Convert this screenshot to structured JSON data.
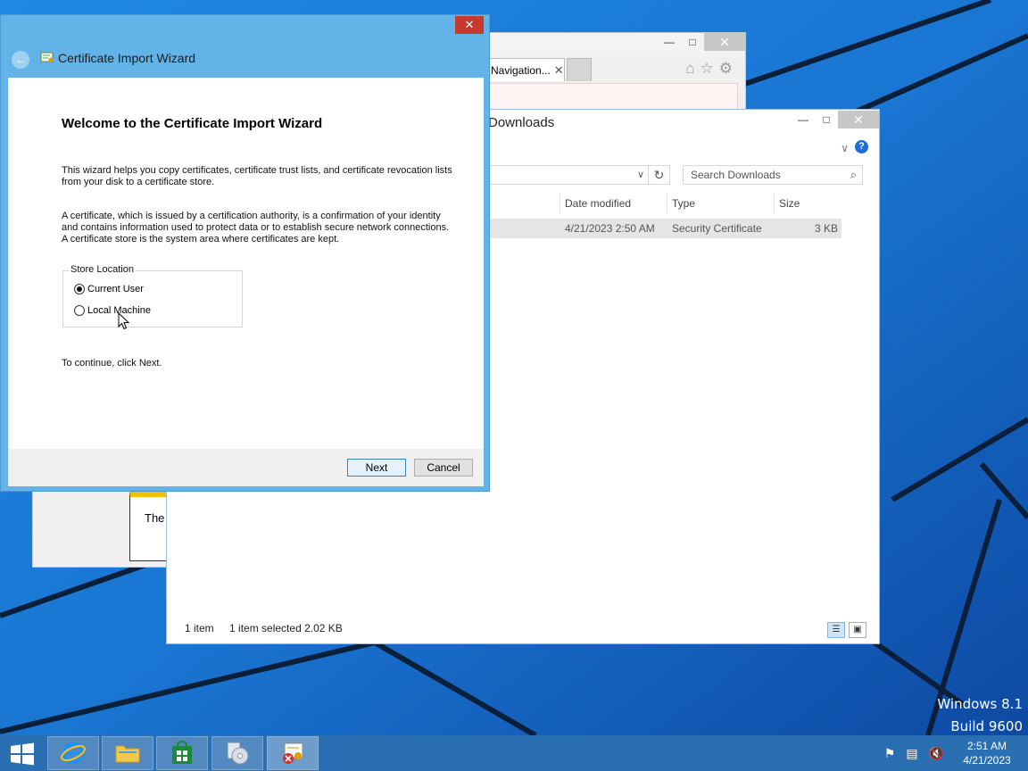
{
  "desktop": {
    "watermark_line1": "Windows 8.1",
    "watermark_line2": "Build 9600"
  },
  "ie": {
    "tab_label": "Navigation...",
    "page_text": "The"
  },
  "explorer": {
    "title": "Downloads",
    "search_placeholder": "Search Downloads",
    "columns": {
      "date_modified": "Date modified",
      "type": "Type",
      "size": "Size"
    },
    "file": {
      "date_modified": "4/21/2023 2:50 AM",
      "type": "Security Certificate",
      "size": "3 KB"
    },
    "status": {
      "count": "1 item",
      "selected": "1 item selected  2.02 KB"
    }
  },
  "wizard": {
    "title": "Certificate Import Wizard",
    "heading": "Welcome to the Certificate Import Wizard",
    "para1": "This wizard helps you copy certificates, certificate trust lists, and certificate revocation lists from your disk to a certificate store.",
    "para2": "A certificate, which is issued by a certification authority, is a confirmation of your identity and contains information used to protect data or to establish secure network connections. A certificate store is the system area where certificates are kept.",
    "store_location": {
      "legend": "Store Location",
      "options": [
        {
          "label": "Current User",
          "selected": true
        },
        {
          "label": "Local Machine",
          "selected": false
        }
      ]
    },
    "continue_text": "To continue, click Next.",
    "next_label": "Next",
    "cancel_label": "Cancel"
  },
  "taskbar": {
    "clock_time": "2:51 AM",
    "clock_date": "4/21/2023"
  },
  "colors": {
    "wallpaper": "#1565c0",
    "taskbar": "#2b6fb3",
    "wizard_frame": "#62b4e8",
    "close_red": "#c7382f"
  }
}
